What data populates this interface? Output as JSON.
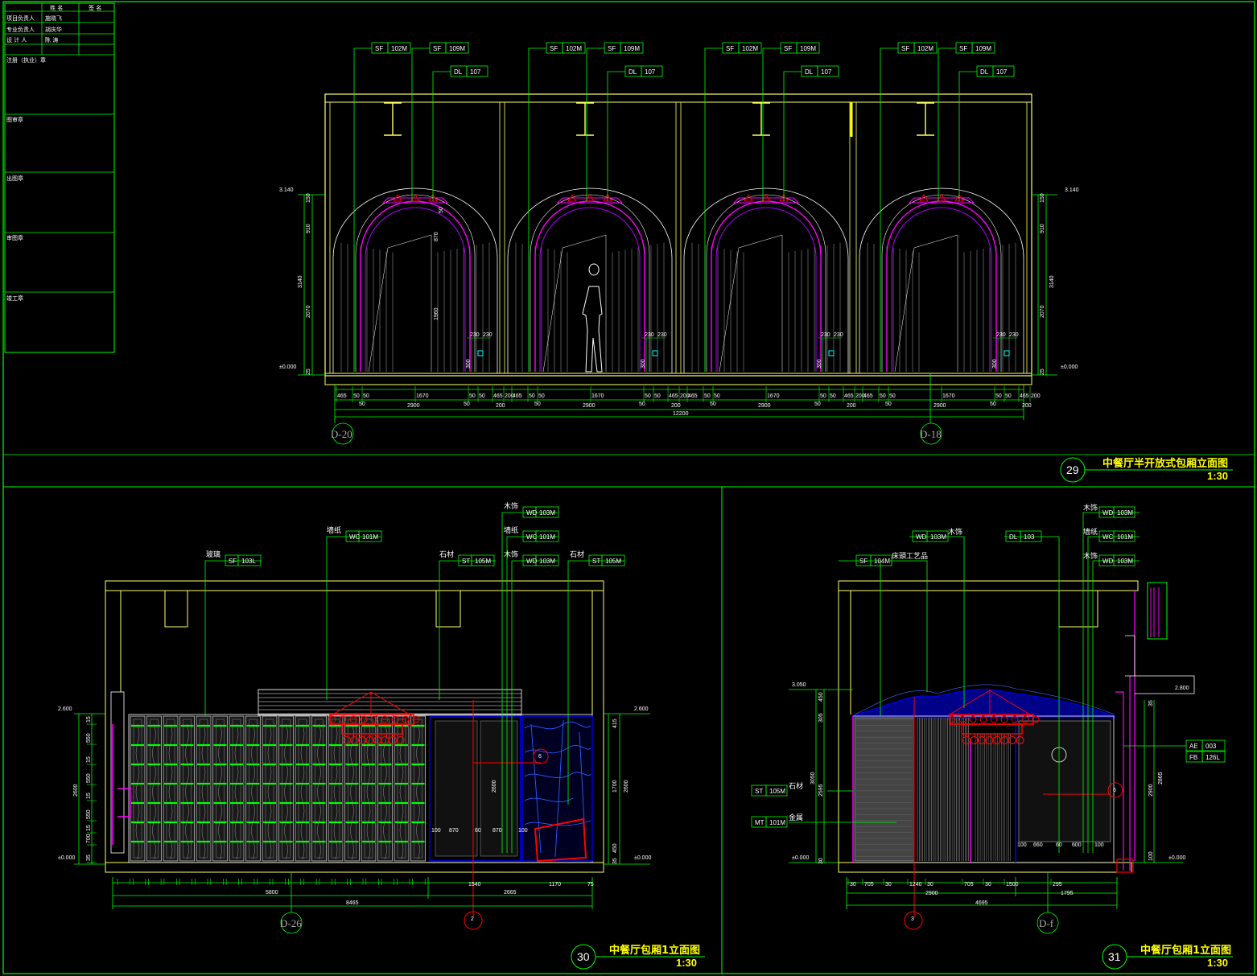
{
  "colors": {
    "frame": "#00ff00",
    "wall": "#ffff66",
    "detail": "#ff00ff",
    "accent": "#ff0000",
    "hatch": "#0000ff",
    "text": "#ffffff",
    "title": "#ffff00"
  },
  "title_block": {
    "rows": [
      {
        "label": "",
        "name": "姓 名",
        "sign": "签 名"
      },
      {
        "label": "项目负责人",
        "name": "施晓飞",
        "sign": ""
      },
      {
        "label": "专业负责人",
        "name": "胡庆华",
        "sign": ""
      },
      {
        "label": "设 计 人",
        "name": "陈 涛",
        "sign": ""
      }
    ],
    "sections": [
      "注册（执业）章",
      "图审章",
      "出图章",
      "审图章",
      "竣工章"
    ]
  },
  "views": [
    {
      "number": "29",
      "title": "中餐厅半开放式包厢立面图",
      "scale": "1:30"
    },
    {
      "number": "30",
      "title": "中餐厅包厢1立面图",
      "scale": "1:30"
    },
    {
      "number": "31",
      "title": "中餐厅包厢1立面图",
      "scale": "1:30"
    }
  ],
  "view29": {
    "tags_sf": [
      "SF",
      "102M",
      "SF",
      "109M"
    ],
    "tag_dl": [
      "DL",
      "107"
    ],
    "levels_left": [
      "3.140",
      "±0.000"
    ],
    "levels_right": [
      "3.140",
      "±0.000"
    ],
    "vert_dims": [
      "150",
      "910",
      "3140",
      "2070",
      "25"
    ],
    "arch_dims": [
      "50",
      "870",
      "1960",
      "230",
      "230",
      "300"
    ],
    "bottom_row1": [
      "465",
      "50",
      "50",
      "1670",
      "50",
      "50",
      "465",
      "200"
    ],
    "bottom_row2": [
      "50",
      "2900",
      "50",
      "200"
    ],
    "total": "12200",
    "axes": [
      "D-20",
      "D-18"
    ]
  },
  "view30": {
    "notes": [
      {
        "text": "玻璃",
        "code1": "SF",
        "code2": "103L"
      },
      {
        "text": "墙纸",
        "code1": "WC",
        "code2": "101M"
      },
      {
        "text": "石材",
        "code1": "ST",
        "code2": "105M"
      },
      {
        "text": "木饰",
        "code1": "WD",
        "code2": "103M"
      },
      {
        "text": "墙纸",
        "code1": "WC",
        "code2": "101M"
      },
      {
        "text": "木饰",
        "code1": "WD",
        "code2": "103M"
      },
      {
        "text": "石材",
        "code1": "ST",
        "code2": "105M"
      }
    ],
    "levels": [
      "2.600",
      "±0.000",
      "2.600",
      "±0.000"
    ],
    "left_dims": [
      "15",
      "550",
      "15",
      "550",
      "15",
      "550",
      "15",
      "700",
      "35",
      "2600"
    ],
    "right_dims": [
      "415",
      "1700",
      "2600",
      "450",
      "35"
    ],
    "mid_dims": [
      "100",
      "870",
      "60",
      "870",
      "100",
      "2600"
    ],
    "bottom_row1": [
      "5800",
      "1540",
      "1170",
      "75"
    ],
    "bottom_row2": [
      "5800",
      "2665"
    ],
    "total": "8465",
    "axis": "D-26",
    "bubble_bottom": "2",
    "bubble_mid": "6"
  },
  "view31": {
    "notes": [
      {
        "text": "",
        "code1": "SF",
        "code2": "104M"
      },
      {
        "text": "床頭工艺品",
        "code1": "",
        "code2": ""
      },
      {
        "text": "木饰",
        "code1": "WD",
        "code2": "103M"
      },
      {
        "text": "",
        "code1": "DL",
        "code2": "103"
      },
      {
        "text": "木饰",
        "code1": "WD",
        "code2": "103M"
      },
      {
        "text": "墙纸",
        "code1": "WC",
        "code2": "101M"
      },
      {
        "text": "木饰",
        "code1": "WD",
        "code2": "103M"
      },
      {
        "text": "石材",
        "code1": "ST",
        "code2": "105M"
      },
      {
        "text": "金属",
        "code1": "MT",
        "code2": "101M"
      },
      {
        "text": "",
        "code1": "AE",
        "code2": "003"
      },
      {
        "text": "",
        "code1": "FB",
        "code2": "126L"
      }
    ],
    "levels": [
      "3.050",
      "±0.000",
      "2.800",
      "±0.000"
    ],
    "left_dims": [
      "450",
      "305",
      "3050",
      "2595",
      "30"
    ],
    "right_dims": [
      "35",
      "2900",
      "2865",
      "100"
    ],
    "mid_dims": [
      "100",
      "660",
      "60",
      "600",
      "100"
    ],
    "bottom_row1": [
      "30",
      "705",
      "30",
      "1240",
      "30",
      "705",
      "30",
      "1500",
      "295"
    ],
    "bottom_row2": [
      "2900",
      "1795"
    ],
    "total": "4695",
    "axis": "D-f",
    "bubble_bottom": "3",
    "bubble_mid": "6"
  }
}
